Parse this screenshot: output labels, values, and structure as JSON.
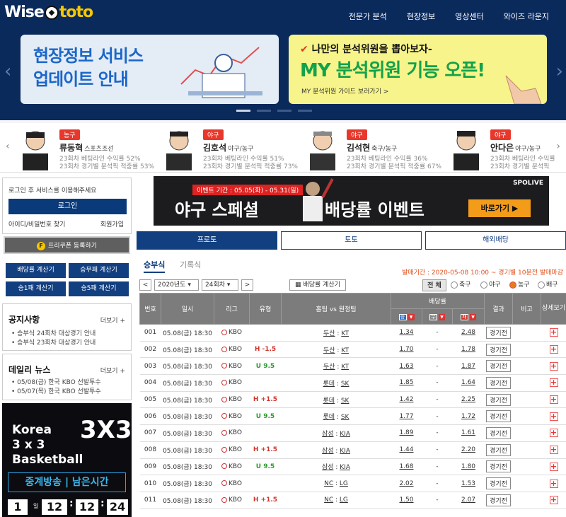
{
  "header": {
    "logo_left": "Wise",
    "logo_right": "toto",
    "nav": [
      "전문가 분석",
      "현장정보",
      "영상센터",
      "와이즈 라운지"
    ]
  },
  "banners": {
    "b1_line1": "현장정보 서비스",
    "b1_line2": "업데이트 안내",
    "b2_pre": "나만의 분석위원을 뽑아보자-",
    "b2_title": "MY 분석위원 기능 오픈!",
    "b2_link": "MY 분석위원 가이드 보러가기 >"
  },
  "analysts": [
    {
      "tag": "농구",
      "name": "류동혁",
      "sub": "스포츠조선",
      "l1": "23회차 베팅라인 수익률 52%",
      "l2": "23회차 경기별 분석픽 적중률 53%"
    },
    {
      "tag": "야구",
      "name": "김호석",
      "sub": "야구/농구",
      "l1": "23회차 베팅라인 수익률 51%",
      "l2": "23회차 경기별 분석픽 적중률 73%"
    },
    {
      "tag": "야구",
      "name": "김석현",
      "sub": "축구/농구",
      "l1": "23회차 베팅라인 수익률 36%",
      "l2": "23회차 경기별 분석픽 적중률 67%"
    },
    {
      "tag": "야구",
      "name": "안다은",
      "sub": "야구/농구",
      "l1": "23회차 베팅라인 수익률",
      "l2": "23회차 경기별 분석픽"
    }
  ],
  "login": {
    "msg": "로그인 후 서비스를 이용해주세요",
    "button": "로그인",
    "find": "아이디/비밀번호 찾기",
    "join": "회원가입",
    "coupon": "프리쿠폰 등록하기",
    "coupon_icon": "F"
  },
  "calcs": [
    "배당률 계산기",
    "승무패 계산기",
    "승1패 계산기",
    "승5패 계산기"
  ],
  "notice": {
    "title": "공지사항",
    "more": "더보기 +",
    "items": [
      "승부식 24회차 대상경기 안내",
      "승부식 23회차 대상경기 안내"
    ]
  },
  "news": {
    "title": "데일리 뉴스",
    "more": "더보기 +",
    "items": [
      "05/08(금) 한국 KBO 선발투수",
      "05/07(목) 한국 KBO 선발투수"
    ]
  },
  "bball": {
    "l1": "Korea",
    "l2": "3 x 3",
    "l3": "Basketball",
    "logo": "3X3",
    "bar": "중계방송 | 남은시간",
    "days": "1",
    "days_label": "일",
    "h": "12",
    "m": "12",
    "s": "24",
    "colon": ":"
  },
  "ad": {
    "period": "이벤트 기간 : 05.05(화) - 05.31(일)",
    "t1": "야구 스페셜",
    "t2": "배당률 이벤트",
    "brand": "SPOLIVE",
    "go": "바로가기 ▶"
  },
  "tabs": [
    "프로토",
    "토토",
    "해외배당"
  ],
  "subtabs": [
    "승부식",
    "기록식"
  ],
  "sale": "발매기간 : 2020-05-08 10:00 ~ 경기별 10분전 발매마감",
  "controls": {
    "prev": "<",
    "next": ">",
    "year": "2020년도",
    "round": "24회차",
    "calc": "배당률 계산기",
    "all": "전 체",
    "f1": "축구",
    "f2": "야구",
    "f3": "농구",
    "f4": "배구"
  },
  "table": {
    "headers": {
      "no": "번호",
      "date": "일시",
      "league": "리그",
      "type": "유형",
      "teams": "홈팀 vs 원정팀",
      "odds": "배당률",
      "result": "결과",
      "note": "비고",
      "detail": "상세보기",
      "w": "승",
      "d": "무",
      "l": "패"
    },
    "rows": [
      {
        "no": "001",
        "date": "05.08(금) 18:30",
        "league": "KBO",
        "type": "",
        "home": "두산",
        "away": "KT",
        "w": "1.34",
        "d": "-",
        "l": "2.48",
        "res": "경기전"
      },
      {
        "no": "002",
        "date": "05.08(금) 18:30",
        "league": "KBO",
        "type": "H -1.5",
        "home": "두산",
        "away": "KT",
        "w": "1.70",
        "d": "-",
        "l": "1.78",
        "res": "경기전"
      },
      {
        "no": "003",
        "date": "05.08(금) 18:30",
        "league": "KBO",
        "type": "U 9.5",
        "home": "두산",
        "away": "KT",
        "w": "1.63",
        "d": "-",
        "l": "1.87",
        "res": "경기전"
      },
      {
        "no": "004",
        "date": "05.08(금) 18:30",
        "league": "KBO",
        "type": "",
        "home": "롯데",
        "away": "SK",
        "w": "1.85",
        "d": "-",
        "l": "1.64",
        "res": "경기전"
      },
      {
        "no": "005",
        "date": "05.08(금) 18:30",
        "league": "KBO",
        "type": "H +1.5",
        "home": "롯데",
        "away": "SK",
        "w": "1.42",
        "d": "-",
        "l": "2.25",
        "res": "경기전"
      },
      {
        "no": "006",
        "date": "05.08(금) 18:30",
        "league": "KBO",
        "type": "U 9.5",
        "home": "롯데",
        "away": "SK",
        "w": "1.77",
        "d": "-",
        "l": "1.72",
        "res": "경기전"
      },
      {
        "no": "007",
        "date": "05.08(금) 18:30",
        "league": "KBO",
        "type": "",
        "home": "삼성",
        "away": "KIA",
        "w": "1.89",
        "d": "-",
        "l": "1.61",
        "res": "경기전"
      },
      {
        "no": "008",
        "date": "05.08(금) 18:30",
        "league": "KBO",
        "type": "H +1.5",
        "home": "삼성",
        "away": "KIA",
        "w": "1.44",
        "d": "-",
        "l": "2.20",
        "res": "경기전"
      },
      {
        "no": "009",
        "date": "05.08(금) 18:30",
        "league": "KBO",
        "type": "U 9.5",
        "home": "삼성",
        "away": "KIA",
        "w": "1.68",
        "d": "-",
        "l": "1.80",
        "res": "경기전"
      },
      {
        "no": "010",
        "date": "05.08(금) 18:30",
        "league": "KBO",
        "type": "",
        "home": "NC",
        "away": "LG",
        "w": "2.02",
        "d": "-",
        "l": "1.53",
        "res": "경기전"
      },
      {
        "no": "011",
        "date": "05.08(금) 18:30",
        "league": "KBO",
        "type": "H +1.5",
        "home": "NC",
        "away": "LG",
        "w": "1.50",
        "d": "-",
        "l": "2.07",
        "res": "경기전"
      }
    ]
  },
  "colors": {
    "navy": "#0b2a5c",
    "button": "#123f80",
    "accent": "#e8382c",
    "handicap_plus": "#d0352c",
    "under": "#2b9a2b"
  }
}
